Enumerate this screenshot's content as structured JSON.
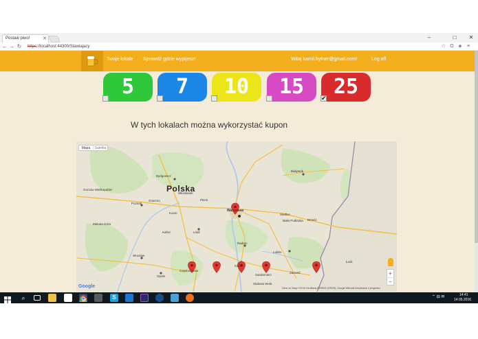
{
  "browser": {
    "tab_title": "Postaw piwo!",
    "url_https": "https",
    "url_rest": "://localhost:44300/Stawiajacy"
  },
  "header": {
    "nav": [
      "Twoje lokale",
      "Sprawdź gdzie wypijesz!"
    ],
    "user_greeting": "Witaj kamil.bytner@gmail.com!",
    "logout": "Log off"
  },
  "coupons": [
    {
      "value": "5",
      "color": "#2fc83a",
      "checked": false
    },
    {
      "value": "7",
      "color": "#1b86e6",
      "checked": false
    },
    {
      "value": "10",
      "color": "#ece51a",
      "checked": false
    },
    {
      "value": "15",
      "color": "#d64bc4",
      "checked": false
    },
    {
      "value": "25",
      "color": "#d92b2b",
      "checked": true
    }
  ],
  "headline": "W tych lokalach można wykorzystać kupon",
  "map": {
    "type_map": "Mapa",
    "type_satellite": "Satelita",
    "country": "Polska",
    "cities": [
      "Bydgoszcz",
      "Warszawa",
      "Białystok",
      "Poznań",
      "Łódź",
      "Radom",
      "Lublin",
      "Kielce",
      "Częstochowa",
      "Wrocław",
      "Opole",
      "Zielona Góra",
      "Kalisz",
      "Siedlce",
      "Płock",
      "Włocławek",
      "Gorzów Wielkopolski",
      "Gniezno",
      "Konin",
      "Biała Podlaska",
      "Zamość",
      "Sandomierz",
      "Stalowa Wola",
      "Łuck",
      "Brześć"
    ],
    "zoom_in": "+",
    "zoom_out": "−",
    "google": "Google",
    "attribution": "Dane do Mapy ©2016 GeoBasis-DE/BKG (©2009), Google   Warunki korzystania z programu"
  },
  "taskbar": {
    "time": "14:41",
    "date": "14.05.2016"
  }
}
